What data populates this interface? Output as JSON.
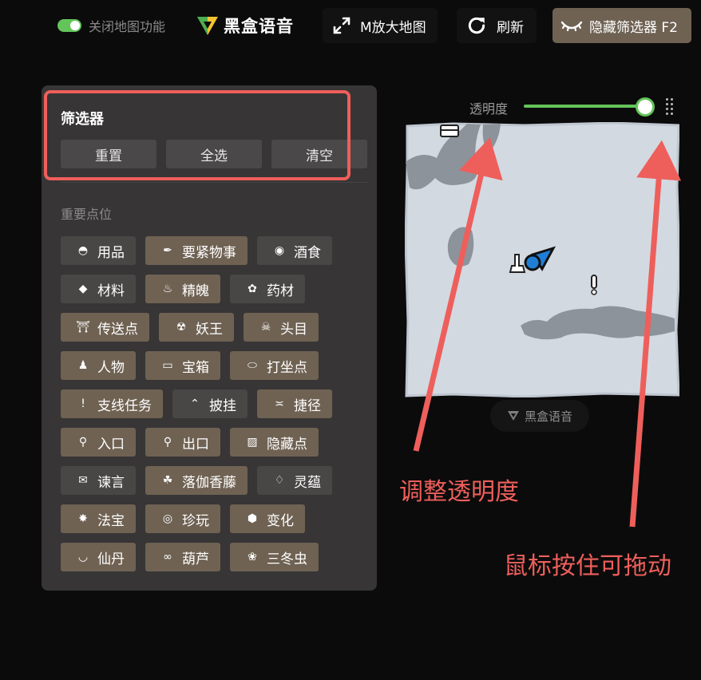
{
  "topbar": {
    "toggle_label": "关闭地图功能",
    "logo_text": "黑盒语音",
    "expand_label": "M放大地图",
    "refresh_label": "刷新",
    "hide_label": "隐藏筛选器 F2"
  },
  "panel": {
    "title": "筛选器",
    "actions": [
      "重置",
      "全选",
      "清空"
    ],
    "section_title": "重要点位",
    "filters": [
      [
        {
          "label": "用品",
          "active": false,
          "icon": "pouch-icon"
        },
        {
          "label": "要紧物事",
          "active": true,
          "icon": "scroll-icon"
        },
        {
          "label": "酒食",
          "active": false,
          "icon": "food-icon"
        }
      ],
      [
        {
          "label": "材料",
          "active": false,
          "icon": "ore-icon"
        },
        {
          "label": "精魄",
          "active": true,
          "icon": "flame-icon"
        },
        {
          "label": "药材",
          "active": false,
          "icon": "herb-icon"
        }
      ],
      [
        {
          "label": "传送点",
          "active": true,
          "icon": "shrine-icon"
        },
        {
          "label": "妖王",
          "active": true,
          "icon": "demon-king-icon"
        },
        {
          "label": "头目",
          "active": true,
          "icon": "boss-skull-icon"
        }
      ],
      [
        {
          "label": "人物",
          "active": true,
          "icon": "person-icon"
        },
        {
          "label": "宝箱",
          "active": true,
          "icon": "chest-icon"
        },
        {
          "label": "打坐点",
          "active": true,
          "icon": "cushion-icon"
        }
      ],
      [
        {
          "label": "支线任务",
          "active": true,
          "icon": "exclamation-icon"
        },
        {
          "label": "披挂",
          "active": false,
          "icon": "armor-icon"
        },
        {
          "label": "捷径",
          "active": true,
          "icon": "shortcut-icon"
        }
      ],
      [
        {
          "label": "入口",
          "active": true,
          "icon": "entrance-pin-icon"
        },
        {
          "label": "出口",
          "active": true,
          "icon": "exit-pin-icon"
        },
        {
          "label": "隐藏点",
          "active": true,
          "icon": "hidden-spot-icon"
        }
      ],
      [
        {
          "label": "谏言",
          "active": false,
          "icon": "speech-bubble-icon"
        },
        {
          "label": "落伽香藤",
          "active": true,
          "icon": "vine-icon"
        },
        {
          "label": "灵蕴",
          "active": false,
          "icon": "spirit-drop-icon"
        }
      ],
      [
        {
          "label": "法宝",
          "active": true,
          "icon": "treasure-icon"
        },
        {
          "label": "珍玩",
          "active": true,
          "icon": "curio-icon"
        },
        {
          "label": "变化",
          "active": true,
          "icon": "transform-icon"
        }
      ],
      [
        {
          "label": "仙丹",
          "active": true,
          "icon": "elixir-icon"
        },
        {
          "label": "葫芦",
          "active": true,
          "icon": "gourd-icon"
        },
        {
          "label": "三冬虫",
          "active": true,
          "icon": "worm-icon"
        }
      ]
    ]
  },
  "map": {
    "opacity_label": "透明度",
    "opacity_value": 1.0,
    "footer_logo": "黑盒语音"
  },
  "annotations": {
    "opacity_note": "调整透明度",
    "drag_note": "鼠标按住可拖动"
  },
  "colors": {
    "accent_green": "#63c45a",
    "active_tag": "#6f6253",
    "inactive_tag": "#494646",
    "annotation_red": "#ee5f5b"
  }
}
